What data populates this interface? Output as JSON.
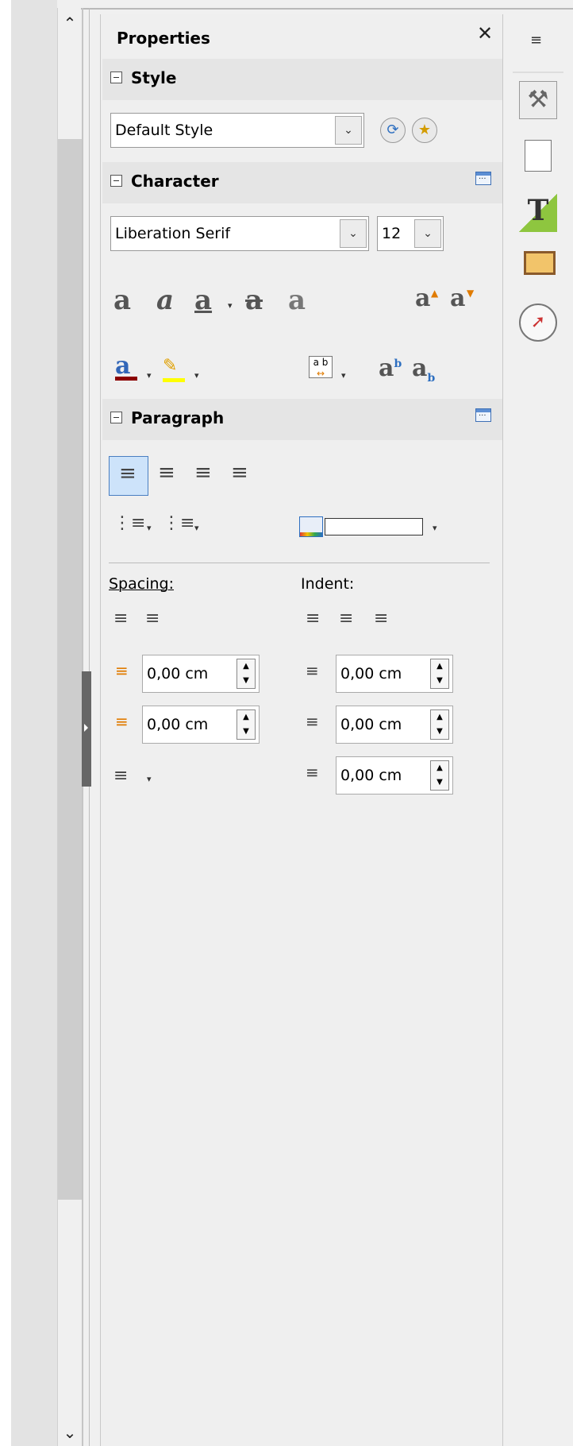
{
  "scrollbar": {
    "up_icon": "chevron-up-icon",
    "down_icon": "chevron-down-icon"
  },
  "panel": {
    "title": "Properties",
    "close_icon": "close-icon"
  },
  "style_section": {
    "title": "Style",
    "paragraph_style": "Default Style",
    "update_icon": "update-style-icon",
    "new_icon": "new-style-icon"
  },
  "character_section": {
    "title": "Character",
    "font_name": "Liberation Serif",
    "font_size": "12",
    "buttons": [
      "bold",
      "italic",
      "underline",
      "strikethrough",
      "shadow",
      "increase-size",
      "decrease-size"
    ],
    "second_row": [
      "font-color",
      "highlighting",
      "character-spacing",
      "superscript",
      "subscript"
    ],
    "font_color": "#8b0000",
    "highlight_color": "#ffff00"
  },
  "paragraph_section": {
    "title": "Paragraph",
    "alignment": [
      "left",
      "center",
      "right",
      "justified"
    ],
    "active_alignment": "left",
    "spacing_label": "Spacing:",
    "indent_label": "Indent:",
    "above_spacing": "0,00 cm",
    "below_spacing": "0,00 cm",
    "before_indent": "0,00 cm",
    "after_indent": "0,00 cm",
    "first_line_indent": "0,00 cm"
  },
  "tabbar": {
    "icons": [
      "properties-icon",
      "page-icon",
      "styles-icon",
      "gallery-icon",
      "navigator-icon"
    ],
    "menu_icon": "sidebar-menu-icon"
  },
  "colors": {
    "accent": "#4a7fc1",
    "active_bg": "#cde3fa"
  }
}
